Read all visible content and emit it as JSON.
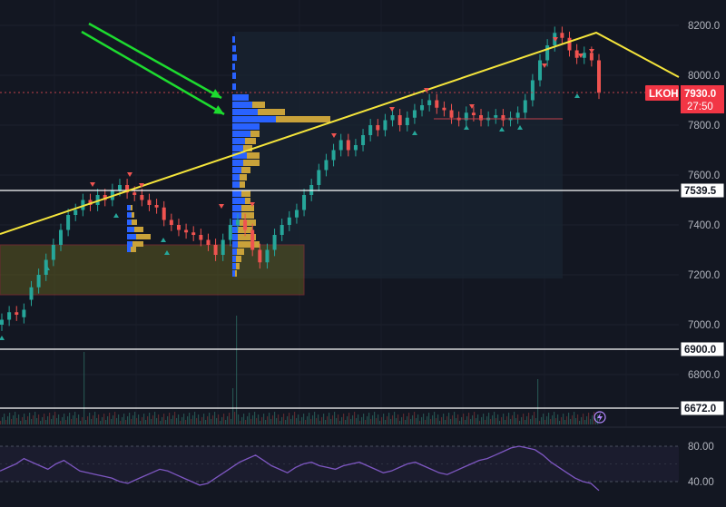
{
  "chart_data": {
    "type": "candlestick",
    "ticker_label": "LKOH",
    "last_price": "7930.0",
    "countdown": "27:50",
    "price_axis": {
      "ticks": [
        "8200.0",
        "8000.0",
        "7800.0",
        "7600.0",
        "7400.0",
        "7200.0",
        "7000.0",
        "6800.0"
      ],
      "ylim": [
        6700,
        8280
      ]
    },
    "horizontal_levels": [
      "7539.5",
      "6900.0",
      "6672.0"
    ],
    "rsi_axis": {
      "ticks": [
        "80.00",
        "40.00"
      ],
      "ylim": [
        20,
        100
      ]
    },
    "trendline_label_points": [
      7850,
      8160,
      8010
    ],
    "rectangle_zone": {
      "from": 7120,
      "to": 7320
    },
    "colors": {
      "background": "#131722",
      "up": "#26a69a",
      "down": "#ef5350",
      "trendline": "#f5e53b",
      "arrows": "#1ddb2f",
      "volume_profile_blue": "#2962ff",
      "volume_profile_gold": "#c9a23a",
      "rsi": "#7e57c2",
      "price_tag": "#f23645",
      "zone_fill": "#5c5a1f"
    },
    "ohlc_series": [
      [
        7000,
        7020
      ],
      [
        7020,
        7050
      ],
      [
        7050,
        7040
      ],
      [
        7030,
        7060
      ],
      [
        7100,
        7150
      ],
      [
        7150,
        7200
      ],
      [
        7200,
        7260
      ],
      [
        7260,
        7320
      ],
      [
        7320,
        7380
      ],
      [
        7380,
        7440
      ],
      [
        7440,
        7460
      ],
      [
        7460,
        7500
      ],
      [
        7500,
        7480
      ],
      [
        7480,
        7520
      ],
      [
        7520,
        7500
      ],
      [
        7500,
        7540
      ],
      [
        7540,
        7560
      ],
      [
        7560,
        7530
      ],
      [
        7530,
        7520
      ],
      [
        7520,
        7500
      ],
      [
        7500,
        7480
      ],
      [
        7480,
        7470
      ],
      [
        7470,
        7420
      ],
      [
        7420,
        7400
      ],
      [
        7400,
        7380
      ],
      [
        7380,
        7370
      ],
      [
        7370,
        7360
      ],
      [
        7360,
        7340
      ],
      [
        7340,
        7320
      ],
      [
        7320,
        7280
      ],
      [
        7280,
        7340
      ],
      [
        7340,
        7400
      ],
      [
        7400,
        7420
      ],
      [
        7420,
        7380
      ],
      [
        7380,
        7300
      ],
      [
        7300,
        7250
      ],
      [
        7250,
        7300
      ],
      [
        7300,
        7360
      ],
      [
        7360,
        7400
      ],
      [
        7400,
        7430
      ],
      [
        7430,
        7460
      ],
      [
        7460,
        7520
      ],
      [
        7520,
        7560
      ],
      [
        7560,
        7620
      ],
      [
        7620,
        7660
      ],
      [
        7660,
        7700
      ],
      [
        7700,
        7740
      ],
      [
        7740,
        7700
      ],
      [
        7700,
        7720
      ],
      [
        7720,
        7760
      ],
      [
        7760,
        7800
      ],
      [
        7800,
        7780
      ],
      [
        7780,
        7820
      ],
      [
        7820,
        7840
      ],
      [
        7840,
        7800
      ],
      [
        7800,
        7830
      ],
      [
        7830,
        7860
      ],
      [
        7860,
        7880
      ],
      [
        7880,
        7900
      ],
      [
        7900,
        7870
      ],
      [
        7870,
        7860
      ],
      [
        7860,
        7830
      ],
      [
        7830,
        7820
      ],
      [
        7820,
        7850
      ],
      [
        7850,
        7840
      ],
      [
        7840,
        7820
      ],
      [
        7820,
        7830
      ],
      [
        7830,
        7840
      ],
      [
        7840,
        7820
      ],
      [
        7820,
        7830
      ],
      [
        7830,
        7850
      ],
      [
        7850,
        7900
      ],
      [
        7900,
        7980
      ],
      [
        7980,
        8060
      ],
      [
        8060,
        8120
      ],
      [
        8120,
        8170
      ],
      [
        8170,
        8150
      ],
      [
        8150,
        8100
      ],
      [
        8100,
        8070
      ],
      [
        8070,
        8090
      ],
      [
        8090,
        8060
      ],
      [
        8060,
        7930
      ]
    ],
    "rsi_series": [
      52,
      56,
      60,
      66,
      62,
      58,
      54,
      60,
      64,
      58,
      52,
      50,
      48,
      46,
      44,
      40,
      38,
      42,
      46,
      50,
      54,
      52,
      48,
      44,
      40,
      36,
      38,
      44,
      50,
      56,
      62,
      66,
      70,
      64,
      58,
      54,
      50,
      56,
      60,
      62,
      58,
      56,
      54,
      58,
      60,
      62,
      58,
      54,
      50,
      52,
      56,
      60,
      62,
      58,
      54,
      50,
      48,
      52,
      56,
      60,
      64,
      66,
      70,
      74,
      78,
      80,
      78,
      76,
      70,
      62,
      56,
      50,
      44,
      40,
      38,
      30
    ]
  }
}
